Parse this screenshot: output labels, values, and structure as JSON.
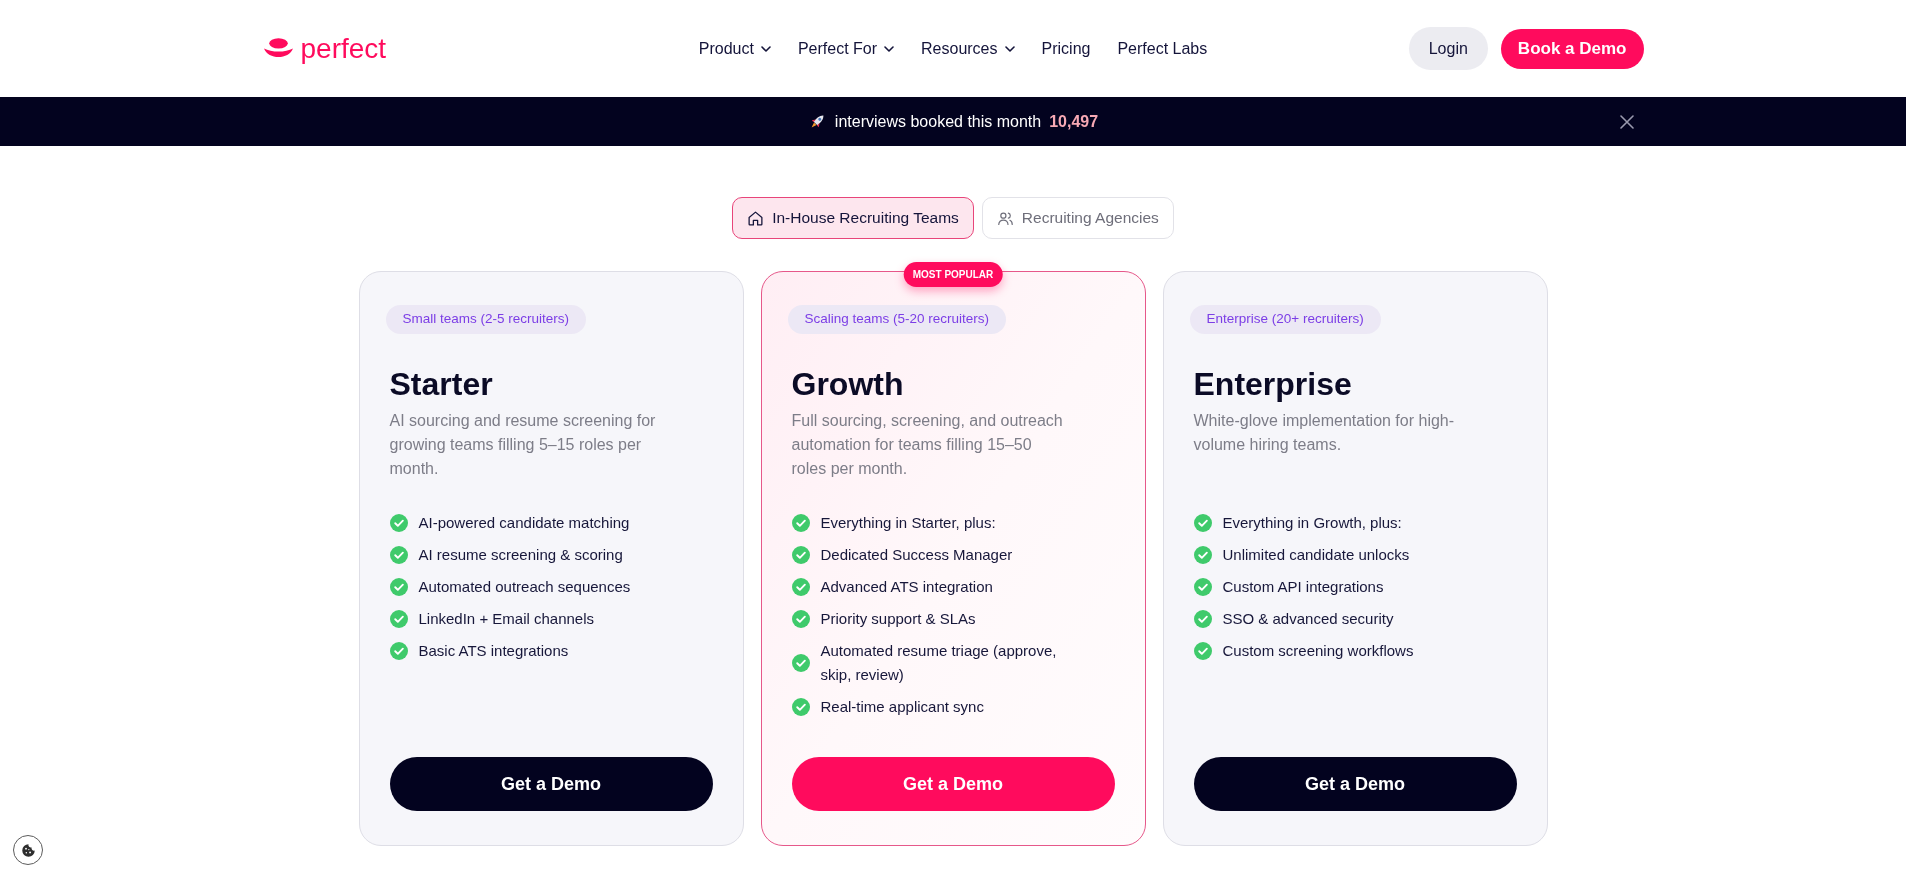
{
  "header": {
    "logo_text": "perfect",
    "nav": [
      {
        "label": "Product",
        "dropdown": true
      },
      {
        "label": "Perfect For",
        "dropdown": true
      },
      {
        "label": "Resources",
        "dropdown": true
      },
      {
        "label": "Pricing",
        "dropdown": false
      },
      {
        "label": "Perfect Labs",
        "dropdown": false
      }
    ],
    "login": "Login",
    "cta": "Book a Demo"
  },
  "announcement": {
    "text": "interviews booked this month",
    "count": "10,497"
  },
  "audience_tabs": [
    {
      "label": "In-House Recruiting Teams",
      "selected": true
    },
    {
      "label": "Recruiting Agencies",
      "selected": false
    }
  ],
  "plans": [
    {
      "audience": "Small teams (2-5 recruiters)",
      "name": "Starter",
      "description": "AI sourcing and resume screening for growing teams filling 5–15 roles per month.",
      "features": [
        "AI-powered candidate matching",
        "AI resume screening & scoring",
        "Automated outreach sequences",
        "LinkedIn + Email channels",
        "Basic ATS integrations"
      ],
      "button": "Get a Demo",
      "featured": false
    },
    {
      "badge": "MOST POPULAR",
      "audience": "Scaling teams (5-20 recruiters)",
      "name": "Growth",
      "description": "Full sourcing, screening, and outreach automation for teams filling 15–50 roles per month.",
      "features": [
        "Everything in Starter, plus:",
        "Dedicated Success Manager",
        "Advanced ATS integration",
        "Priority support & SLAs",
        "Automated resume triage (approve, skip, review)",
        "Real-time applicant sync"
      ],
      "button": "Get a Demo",
      "featured": true
    },
    {
      "audience": "Enterprise (20+ recruiters)",
      "name": "Enterprise",
      "description": "White-glove implementation for high-volume hiring teams.",
      "features": [
        "Everything in Growth, plus:",
        "Unlimited candidate unlocks",
        "Custom API integrations",
        "SSO & advanced security",
        "Custom screening workflows"
      ],
      "button": "Get a Demo",
      "featured": false
    }
  ]
}
